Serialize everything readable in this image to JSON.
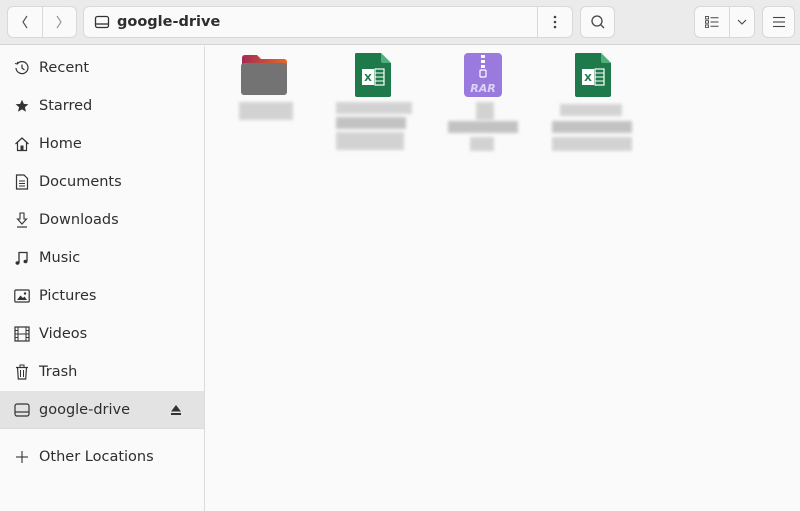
{
  "header": {
    "back_label": "Back",
    "forward_label": "Forward",
    "location_title": "google-drive",
    "location_icon": "drive-icon",
    "path_menu_icon": "vertical-dots-icon",
    "search_icon": "search-icon",
    "view_list_icon": "list-view-icon",
    "view_options_icon": "chevron-down-icon",
    "main_menu_icon": "hamburger-menu-icon"
  },
  "sidebar": {
    "items": [
      {
        "label": "Recent",
        "icon": "clock-icon"
      },
      {
        "label": "Starred",
        "icon": "star-icon"
      },
      {
        "label": "Home",
        "icon": "home-icon"
      },
      {
        "label": "Documents",
        "icon": "document-icon"
      },
      {
        "label": "Downloads",
        "icon": "download-icon"
      },
      {
        "label": "Music",
        "icon": "music-icon"
      },
      {
        "label": "Pictures",
        "icon": "picture-icon"
      },
      {
        "label": "Videos",
        "icon": "film-icon"
      },
      {
        "label": "Trash",
        "icon": "trash-icon"
      },
      {
        "label": "google-drive",
        "icon": "drive-icon",
        "active": true,
        "eject": true
      }
    ],
    "other_locations": {
      "label": "Other Locations",
      "icon": "plus-icon"
    }
  },
  "files": [
    {
      "type": "folder",
      "name_obscured": true
    },
    {
      "type": "spreadsheet",
      "name_obscured": true
    },
    {
      "type": "rar-archive",
      "name_obscured": true,
      "icon_text": "RAR"
    },
    {
      "type": "spreadsheet",
      "name_obscured": true
    }
  ],
  "colors": {
    "folder_body": "#737373",
    "folder_tab": "#a83250",
    "spreadsheet": "#1e7a4a",
    "rar": "#9b7ae0"
  }
}
